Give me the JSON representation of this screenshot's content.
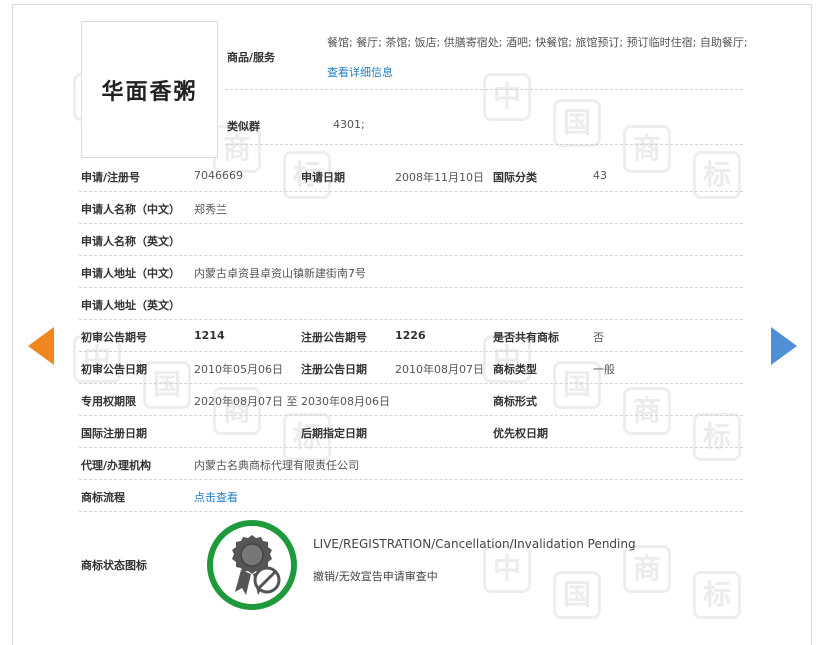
{
  "logo_text": "华面香粥",
  "goods_services": {
    "label": "商品/服务",
    "value": "餐馆; 餐厅; 茶馆; 饭店; 供膳寄宿处; 酒吧; 快餐馆; 旅馆预订; 预订临时住宿; 自助餐厅;",
    "detail_link": "查看详细信息"
  },
  "similar_group": {
    "label": "类似群",
    "value": "4301;"
  },
  "rows": {
    "reg_no": {
      "label": "申请/注册号",
      "value": "7046669"
    },
    "app_date": {
      "label": "申请日期",
      "value": "2008年11月10日"
    },
    "intl_class": {
      "label": "国际分类",
      "value": "43"
    },
    "applicant_cn": {
      "label": "申请人名称（中文）",
      "value": "郑秀兰"
    },
    "applicant_en": {
      "label": "申请人名称（英文）",
      "value": ""
    },
    "address_cn": {
      "label": "申请人地址（中文）",
      "value": "内蒙古卓资县卓资山镇新建街南7号"
    },
    "address_en": {
      "label": "申请人地址（英文）",
      "value": ""
    },
    "prelim_issue": {
      "label": "初审公告期号",
      "value": "1214"
    },
    "reg_issue": {
      "label": "注册公告期号",
      "value": "1226"
    },
    "shared": {
      "label": "是否共有商标",
      "value": "否"
    },
    "prelim_date": {
      "label": "初审公告日期",
      "value": "2010年05月06日"
    },
    "reg_date": {
      "label": "注册公告日期",
      "value": "2010年08月07日"
    },
    "tm_type": {
      "label": "商标类型",
      "value": "一般"
    },
    "exclusive": {
      "label": "专用权期限",
      "value": "2020年08月07日 至 2030年08月06日"
    },
    "tm_form": {
      "label": "商标形式",
      "value": ""
    },
    "intl_reg_date": {
      "label": "国际注册日期",
      "value": ""
    },
    "later_date": {
      "label": "后期指定日期",
      "value": ""
    },
    "priority_date": {
      "label": "优先权日期",
      "value": ""
    },
    "agent": {
      "label": "代理/办理机构",
      "value": "内蒙古名典商标代理有限责任公司"
    },
    "process": {
      "label": "商标流程",
      "link": "点击查看"
    },
    "status": {
      "label": "商标状态图标",
      "en": "LIVE/REGISTRATION/Cancellation/Invalidation Pending",
      "cn": "撤销/无效宣告申请审查中"
    }
  },
  "colors": {
    "link": "#1f7fc4",
    "arrow_left": "#f0861e",
    "arrow_right": "#4f8fd6",
    "status_ring": "#1e9a3c"
  },
  "icons": {
    "prev": "arrow-left-icon",
    "next": "arrow-right-icon",
    "status": "rosette-prohibited-icon"
  }
}
